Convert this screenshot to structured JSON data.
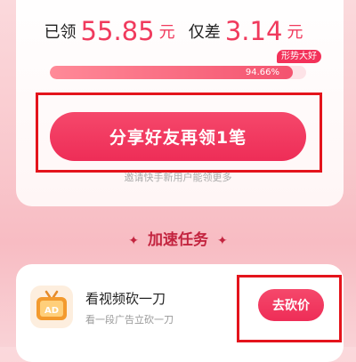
{
  "progress": {
    "received_label": "已领",
    "received_amount": "55.85",
    "received_unit": "元",
    "gap_label": "仅差",
    "gap_amount": "3.14",
    "gap_unit": "元",
    "badge": "形势大好",
    "percent_text": "94.66%",
    "percent_value": 0.9466
  },
  "share": {
    "button_label": "分享好友再领1笔",
    "tip": "邀请快手新用户能领更多"
  },
  "tasks": {
    "section_title": "加速任务",
    "items": [
      {
        "icon": "tv-ad-icon",
        "icon_text": "AD",
        "title": "看视频砍一刀",
        "subtitle": "看一段广告立砍一刀",
        "button_label": "去砍价"
      }
    ]
  },
  "colors": {
    "accent": "#f03a5d",
    "button": "#ee2d57",
    "annotation": "#e4141c"
  }
}
